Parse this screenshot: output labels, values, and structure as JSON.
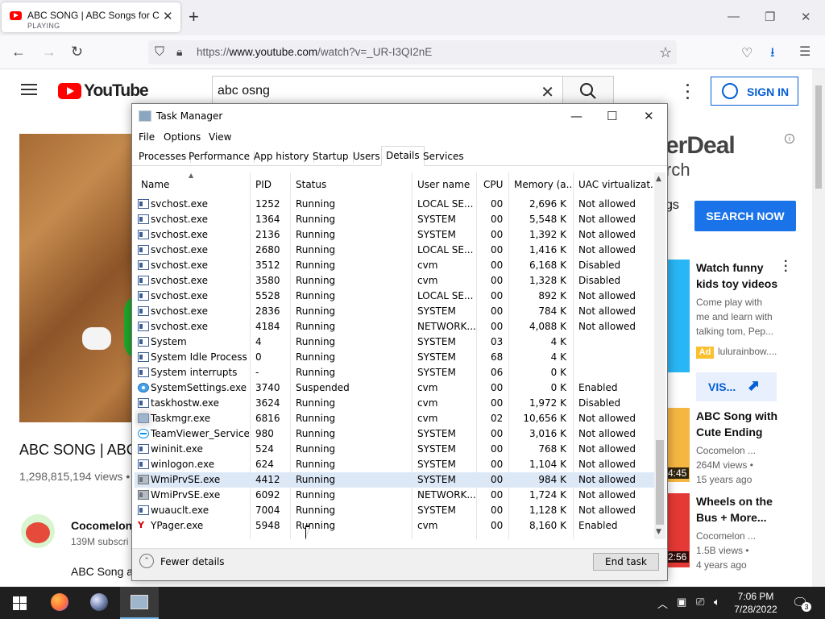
{
  "browser": {
    "tab_title": "ABC SONG | ABC Songs for Chi",
    "tab_status": "PLAYING",
    "url_prefix": "https://",
    "url_host": "www.youtube.com",
    "url_path": "/watch?v=_UR-I3QI2nE"
  },
  "youtube": {
    "logo_text": "YouTube",
    "search_value": "abc osng",
    "sign_in": "SIGN IN",
    "video_title": "ABC SONG | ABC",
    "video_views": "1,298,815,194 views •",
    "channel_name": "Cocomelon",
    "channel_subs": "139M subscri",
    "description": "ABC Song a",
    "ad_logo_line1": "erDeal",
    "ad_logo_line2": "rch",
    "ad_text": "gs",
    "search_now": "SEARCH NOW",
    "suggestions": [
      {
        "title": "Watch funny kids toy videos",
        "meta1": "Come play with",
        "meta2": "me and learn with",
        "meta3": "talking tom, Pep..."
      },
      {
        "title": "ABC Song with Cute Ending",
        "meta1": "Cocomelon ...",
        "meta2": "264M views •",
        "meta3": "15 years ago",
        "time": "4:45"
      },
      {
        "title": "Wheels on the Bus + More...",
        "meta1": "Cocomelon ...",
        "meta2": "1.5B views •",
        "meta3": "4 years ago",
        "time": "2:56"
      }
    ],
    "ad_badge": "Ad",
    "ad_domain": "lulurainbow....",
    "visit_label": "VIS..."
  },
  "task_manager": {
    "title": "Task Manager",
    "menus": [
      "File",
      "Options",
      "View"
    ],
    "tabs": [
      "Processes",
      "Performance",
      "App history",
      "Startup",
      "Users",
      "Details",
      "Services"
    ],
    "active_tab": "Details",
    "columns": [
      "Name",
      "PID",
      "Status",
      "User name",
      "CPU",
      "Memory (a...",
      "UAC virtualizat..."
    ],
    "rows": [
      {
        "name": "svchost.exe",
        "pid": "1252",
        "status": "Running",
        "user": "LOCAL SE...",
        "cpu": "00",
        "mem": "2,696 K",
        "uac": "Not allowed",
        "icon": "svc"
      },
      {
        "name": "svchost.exe",
        "pid": "1364",
        "status": "Running",
        "user": "SYSTEM",
        "cpu": "00",
        "mem": "5,548 K",
        "uac": "Not allowed",
        "icon": "svc"
      },
      {
        "name": "svchost.exe",
        "pid": "2136",
        "status": "Running",
        "user": "SYSTEM",
        "cpu": "00",
        "mem": "1,392 K",
        "uac": "Not allowed",
        "icon": "svc"
      },
      {
        "name": "svchost.exe",
        "pid": "2680",
        "status": "Running",
        "user": "LOCAL SE...",
        "cpu": "00",
        "mem": "1,416 K",
        "uac": "Not allowed",
        "icon": "svc"
      },
      {
        "name": "svchost.exe",
        "pid": "3512",
        "status": "Running",
        "user": "cvm",
        "cpu": "00",
        "mem": "6,168 K",
        "uac": "Disabled",
        "icon": "svc"
      },
      {
        "name": "svchost.exe",
        "pid": "3580",
        "status": "Running",
        "user": "cvm",
        "cpu": "00",
        "mem": "1,328 K",
        "uac": "Disabled",
        "icon": "svc"
      },
      {
        "name": "svchost.exe",
        "pid": "5528",
        "status": "Running",
        "user": "LOCAL SE...",
        "cpu": "00",
        "mem": "892 K",
        "uac": "Not allowed",
        "icon": "svc"
      },
      {
        "name": "svchost.exe",
        "pid": "2836",
        "status": "Running",
        "user": "SYSTEM",
        "cpu": "00",
        "mem": "784 K",
        "uac": "Not allowed",
        "icon": "svc"
      },
      {
        "name": "svchost.exe",
        "pid": "4184",
        "status": "Running",
        "user": "NETWORK...",
        "cpu": "00",
        "mem": "4,088 K",
        "uac": "Not allowed",
        "icon": "svc"
      },
      {
        "name": "System",
        "pid": "4",
        "status": "Running",
        "user": "SYSTEM",
        "cpu": "03",
        "mem": "4 K",
        "uac": "",
        "icon": "svc"
      },
      {
        "name": "System Idle Process",
        "pid": "0",
        "status": "Running",
        "user": "SYSTEM",
        "cpu": "68",
        "mem": "4 K",
        "uac": "",
        "icon": "svc"
      },
      {
        "name": "System interrupts",
        "pid": "-",
        "status": "Running",
        "user": "SYSTEM",
        "cpu": "06",
        "mem": "0 K",
        "uac": "",
        "icon": "svc"
      },
      {
        "name": "SystemSettings.exe",
        "pid": "3740",
        "status": "Suspended",
        "user": "cvm",
        "cpu": "00",
        "mem": "0 K",
        "uac": "Enabled",
        "icon": "gear"
      },
      {
        "name": "taskhostw.exe",
        "pid": "3624",
        "status": "Running",
        "user": "cvm",
        "cpu": "00",
        "mem": "1,972 K",
        "uac": "Disabled",
        "icon": "svc"
      },
      {
        "name": "Taskmgr.exe",
        "pid": "6816",
        "status": "Running",
        "user": "cvm",
        "cpu": "02",
        "mem": "10,656 K",
        "uac": "Not allowed",
        "icon": "tm"
      },
      {
        "name": "TeamViewer_Service....",
        "pid": "980",
        "status": "Running",
        "user": "SYSTEM",
        "cpu": "00",
        "mem": "3,016 K",
        "uac": "Not allowed",
        "icon": "tv"
      },
      {
        "name": "wininit.exe",
        "pid": "524",
        "status": "Running",
        "user": "SYSTEM",
        "cpu": "00",
        "mem": "768 K",
        "uac": "Not allowed",
        "icon": "svc"
      },
      {
        "name": "winlogon.exe",
        "pid": "624",
        "status": "Running",
        "user": "SYSTEM",
        "cpu": "00",
        "mem": "1,104 K",
        "uac": "Not allowed",
        "icon": "svc"
      },
      {
        "name": "WmiPrvSE.exe",
        "pid": "4412",
        "status": "Running",
        "user": "SYSTEM",
        "cpu": "00",
        "mem": "984 K",
        "uac": "Not allowed",
        "icon": "wmi",
        "selected": true
      },
      {
        "name": "WmiPrvSE.exe",
        "pid": "6092",
        "status": "Running",
        "user": "NETWORK...",
        "cpu": "00",
        "mem": "1,724 K",
        "uac": "Not allowed",
        "icon": "wmi"
      },
      {
        "name": "wuauclt.exe",
        "pid": "7004",
        "status": "Running",
        "user": "SYSTEM",
        "cpu": "00",
        "mem": "1,128 K",
        "uac": "Not allowed",
        "icon": "svc"
      },
      {
        "name": "YPager.exe",
        "pid": "5948",
        "status": "Running",
        "user": "cvm",
        "cpu": "00",
        "mem": "8,160 K",
        "uac": "Enabled",
        "icon": "ypager"
      }
    ],
    "fewer_details": "Fewer details",
    "end_task": "End task"
  },
  "taskbar": {
    "time": "7:06 PM",
    "date": "7/28/2022",
    "notifications": "3"
  },
  "colors": {
    "youtube_red": "#ff0000",
    "link_blue": "#065fd4",
    "search_now_blue": "#1a73e8",
    "selected_row": "#dde8f7",
    "taskbar": "#1f1f1f"
  }
}
